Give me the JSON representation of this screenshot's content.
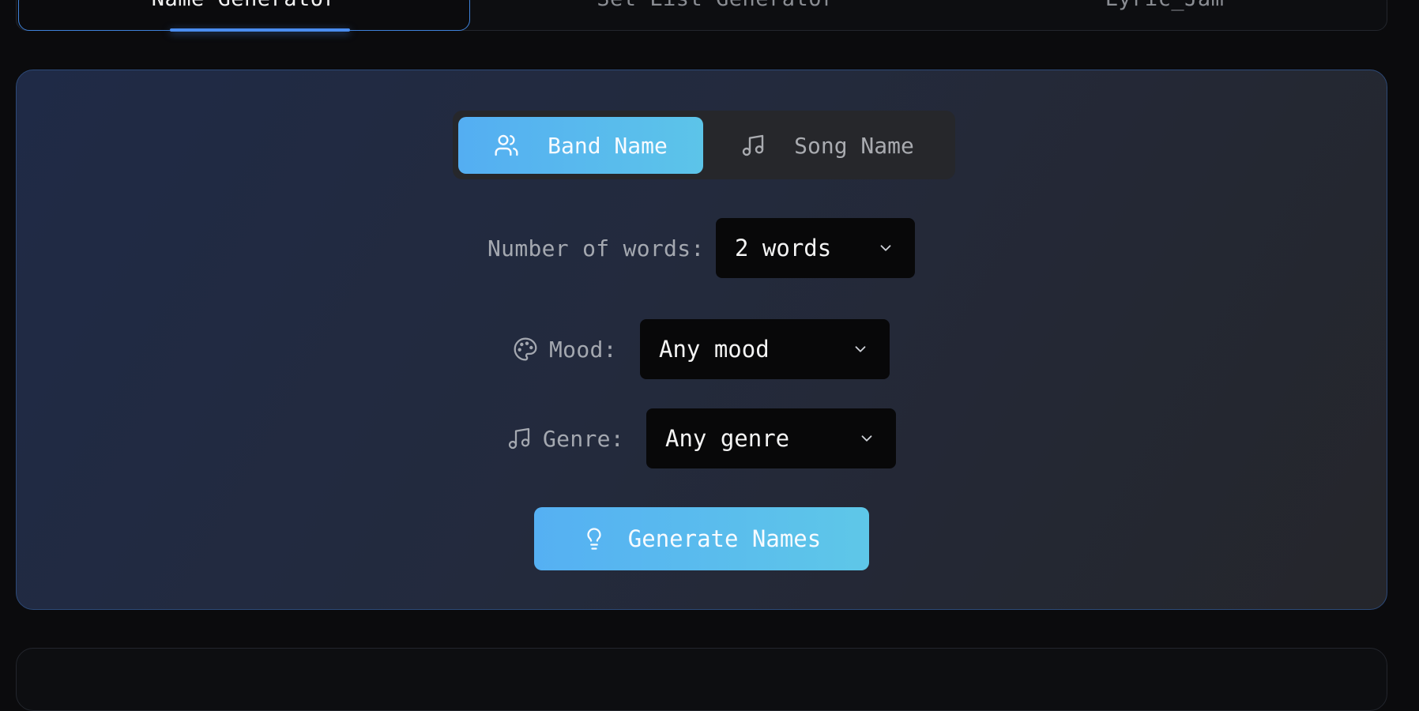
{
  "tabs": [
    {
      "label": "Name Generator",
      "active": true
    },
    {
      "label": "Set List Generator",
      "active": false
    },
    {
      "label": "Lyric_Jam",
      "active": false
    }
  ],
  "mode_toggle": {
    "band_label": "Band Name",
    "song_label": "Song Name",
    "selected": "Band Name"
  },
  "words": {
    "label": "Number of words:",
    "value": "2 words"
  },
  "mood": {
    "label": "Mood:",
    "value": "Any mood"
  },
  "genre": {
    "label": "Genre:",
    "value": "Any genre"
  },
  "generate_button": {
    "label": "Generate Names"
  },
  "colors": {
    "accent": "#4a8df0",
    "button_gradient_start": "#55b0f3",
    "button_gradient_end": "#5ec7e8",
    "panel_border": "#2d4a78"
  },
  "icons": {
    "band": "users-icon",
    "song": "music-note-icon",
    "mood": "palette-icon",
    "genre": "music-note-icon",
    "generate": "lightbulb-icon",
    "dropdown": "chevron-down-icon"
  }
}
